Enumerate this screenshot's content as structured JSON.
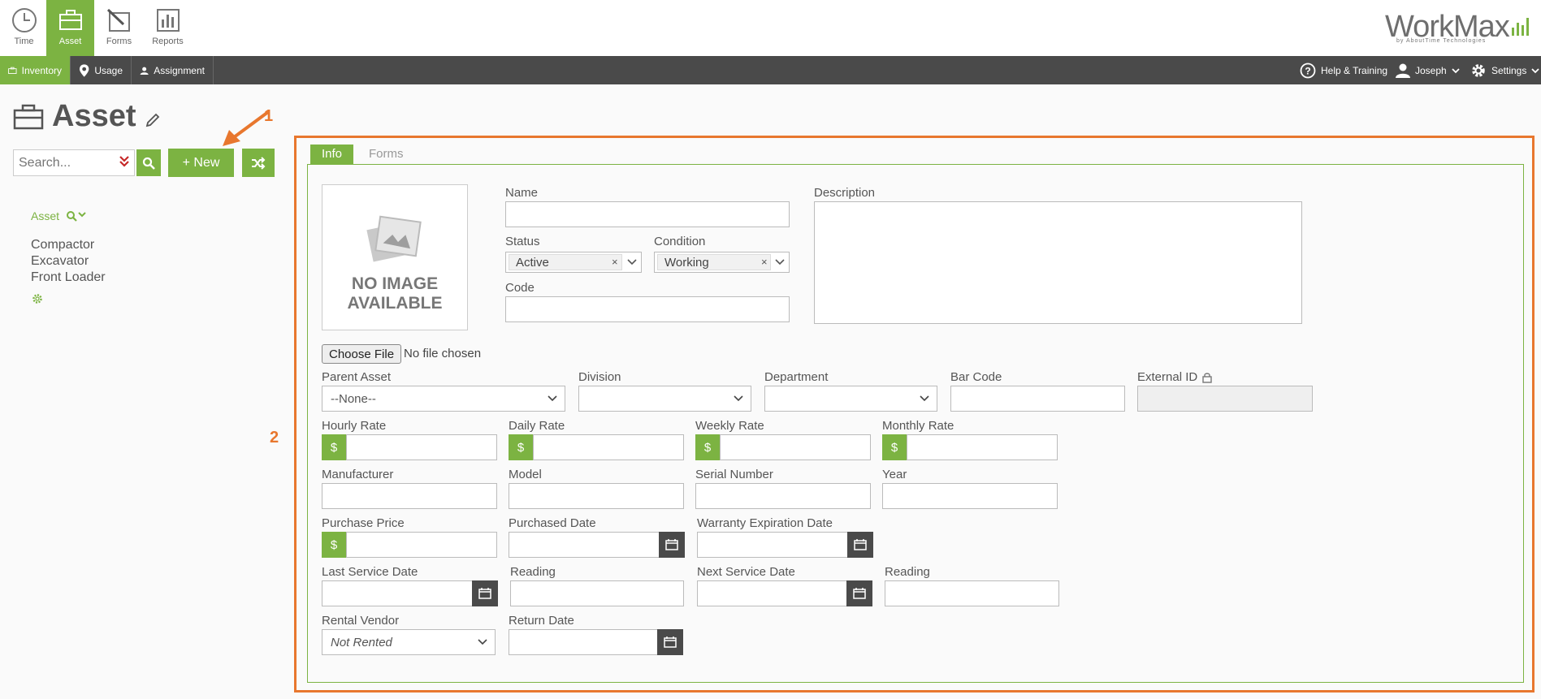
{
  "apps": [
    {
      "label": "Time",
      "icon": "clock-icon"
    },
    {
      "label": "Asset",
      "icon": "briefcase-icon"
    },
    {
      "label": "Forms",
      "icon": "forms-icon"
    },
    {
      "label": "Reports",
      "icon": "reports-icon"
    }
  ],
  "logo": {
    "word": "WorkMax",
    "sub": "by AboutTime Technologies"
  },
  "nav": {
    "items": [
      "Inventory",
      "Usage",
      "Assignment"
    ],
    "help": "Help & Training",
    "user": "Joseph",
    "settings": "Settings"
  },
  "page": {
    "title": "Asset"
  },
  "search": {
    "placeholder": "Search..."
  },
  "new_button": "+ New",
  "tree": {
    "root": "Asset",
    "items": [
      "Compactor",
      "Excavator",
      "Front Loader"
    ]
  },
  "annotations": {
    "one": "1",
    "two": "2"
  },
  "form": {
    "tabs": [
      "Info",
      "Forms"
    ],
    "no_image": {
      "line1": "NO IMAGE",
      "line2": "AVAILABLE"
    },
    "file": {
      "button": "Choose File",
      "status": "No file chosen"
    },
    "labels": {
      "name": "Name",
      "status": "Status",
      "condition": "Condition",
      "code": "Code",
      "description": "Description",
      "parent_asset": "Parent Asset",
      "division": "Division",
      "department": "Department",
      "bar_code": "Bar Code",
      "external_id": "External ID",
      "hourly_rate": "Hourly Rate",
      "daily_rate": "Daily Rate",
      "weekly_rate": "Weekly Rate",
      "monthly_rate": "Monthly Rate",
      "manufacturer": "Manufacturer",
      "model": "Model",
      "serial_number": "Serial Number",
      "year": "Year",
      "purchase_price": "Purchase Price",
      "purchased_date": "Purchased Date",
      "warranty_expiration": "Warranty Expiration Date",
      "last_service_date": "Last Service Date",
      "reading": "Reading",
      "next_service_date": "Next Service Date",
      "reading2": "Reading",
      "rental_vendor": "Rental Vendor",
      "return_date": "Return Date"
    },
    "values": {
      "status": "Active",
      "condition": "Working",
      "parent_asset": "--None--",
      "rental_vendor": "Not Rented",
      "currency": "$"
    }
  },
  "colors": {
    "accent": "#7cb342",
    "annotation": "#e8772e",
    "nav": "#4a4a4a"
  }
}
